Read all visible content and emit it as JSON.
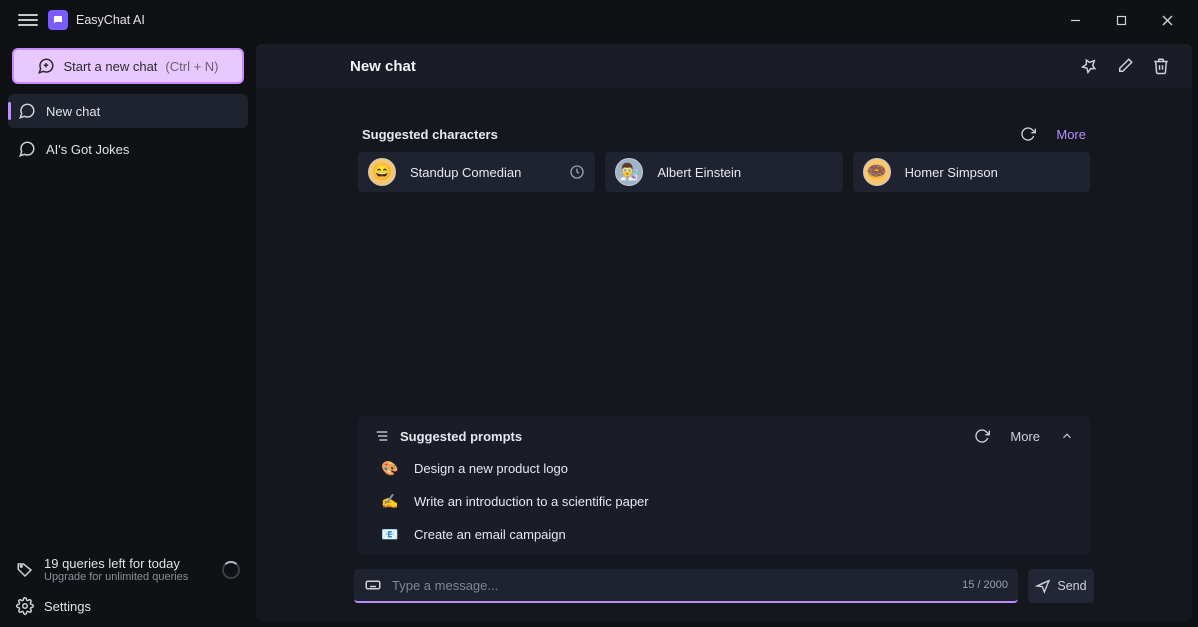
{
  "app": {
    "title": "EasyChat AI"
  },
  "sidebar": {
    "new_chat_label": "Start a new chat",
    "new_chat_shortcut": "(Ctrl + N)",
    "chats": [
      {
        "label": "New chat",
        "active": true
      },
      {
        "label": "AI's Got Jokes",
        "active": false
      }
    ],
    "usage_line1": "19 queries left for today",
    "usage_line2": "Upgrade for unlimited queries",
    "settings_label": "Settings"
  },
  "header": {
    "title": "New chat"
  },
  "characters": {
    "title": "Suggested characters",
    "more_label": "More",
    "items": [
      {
        "name": "Standup Comedian",
        "emoji": "😄",
        "recent": true
      },
      {
        "name": "Albert Einstein",
        "emoji": "👨‍🔬",
        "recent": false
      },
      {
        "name": "Homer Simpson",
        "emoji": "🍩",
        "recent": false
      }
    ]
  },
  "prompts": {
    "title": "Suggested prompts",
    "more_label": "More",
    "items": [
      {
        "emoji": "🎨",
        "text": "Design a new product logo"
      },
      {
        "emoji": "✍️",
        "text": "Write an introduction to a scientific paper"
      },
      {
        "emoji": "📧",
        "text": "Create an email campaign"
      }
    ]
  },
  "input": {
    "placeholder": "Type a message...",
    "char_count": "15 / 2000",
    "send_label": "Send"
  }
}
